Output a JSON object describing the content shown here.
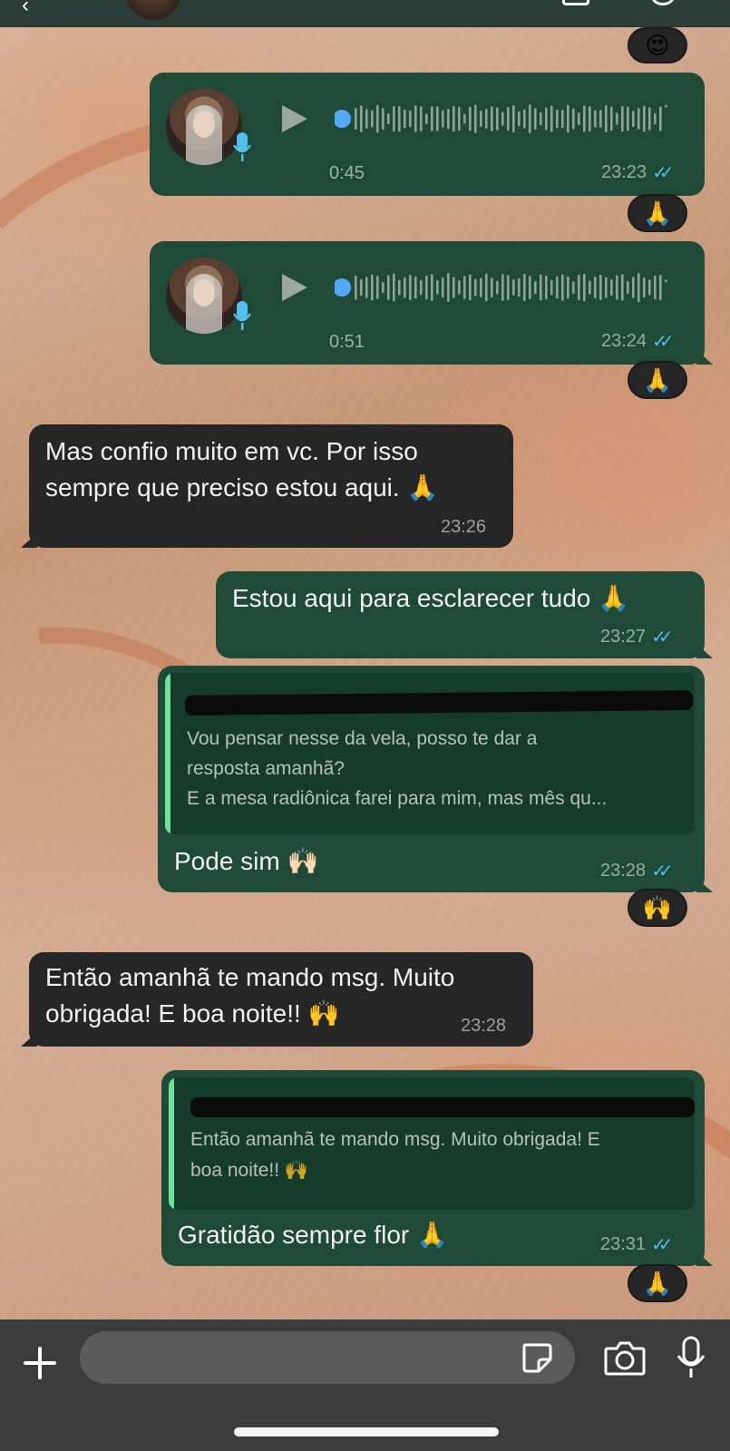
{
  "colors": {
    "outgoing_bubble": "#1f4a37",
    "incoming_bubble": "#262626",
    "read_ticks": "#53bdeb",
    "quote_accent": "#6ee19a"
  },
  "messages": {
    "voice1": {
      "duration": "0:45",
      "time": "23:23",
      "status_icon": "double-check-read-icon"
    },
    "voice2": {
      "duration": "0:51",
      "time": "23:24",
      "status_icon": "double-check-read-icon"
    },
    "in1": {
      "line1": "Mas confio muito em vc. Por isso",
      "line2": "sempre que preciso estou aqui. 🙏",
      "time": "23:26"
    },
    "out1": {
      "text": "Estou aqui para esclarecer tudo 🙏",
      "time": "23:27"
    },
    "out2": {
      "quote_line1": "Vou pensar nesse da vela, posso te dar a",
      "quote_line2": "resposta amanhã?",
      "quote_line3": "E a mesa radiônica farei para mim, mas mês qu...",
      "text": "Pode sim 🙌🏻",
      "time": "23:28"
    },
    "in2": {
      "line1": "Então amanhã te mando msg. Muito",
      "line2": "obrigada! E boa noite!! 🙌",
      "time": "23:28"
    },
    "out3": {
      "quote_line1": "Então amanhã te mando msg. Muito obrigada! E",
      "quote_line2": "boa noite!! 🙌",
      "text": "Gratidão sempre flor 🙏",
      "time": "23:31"
    }
  },
  "reactions": {
    "r0": "😍",
    "r1": "🙏",
    "r2": "🙏",
    "r3": "🙌",
    "r4": "🙏"
  },
  "composer": {
    "placeholder": "",
    "icons": [
      "plus-icon",
      "sticker-icon",
      "camera-icon",
      "microphone-icon"
    ]
  }
}
